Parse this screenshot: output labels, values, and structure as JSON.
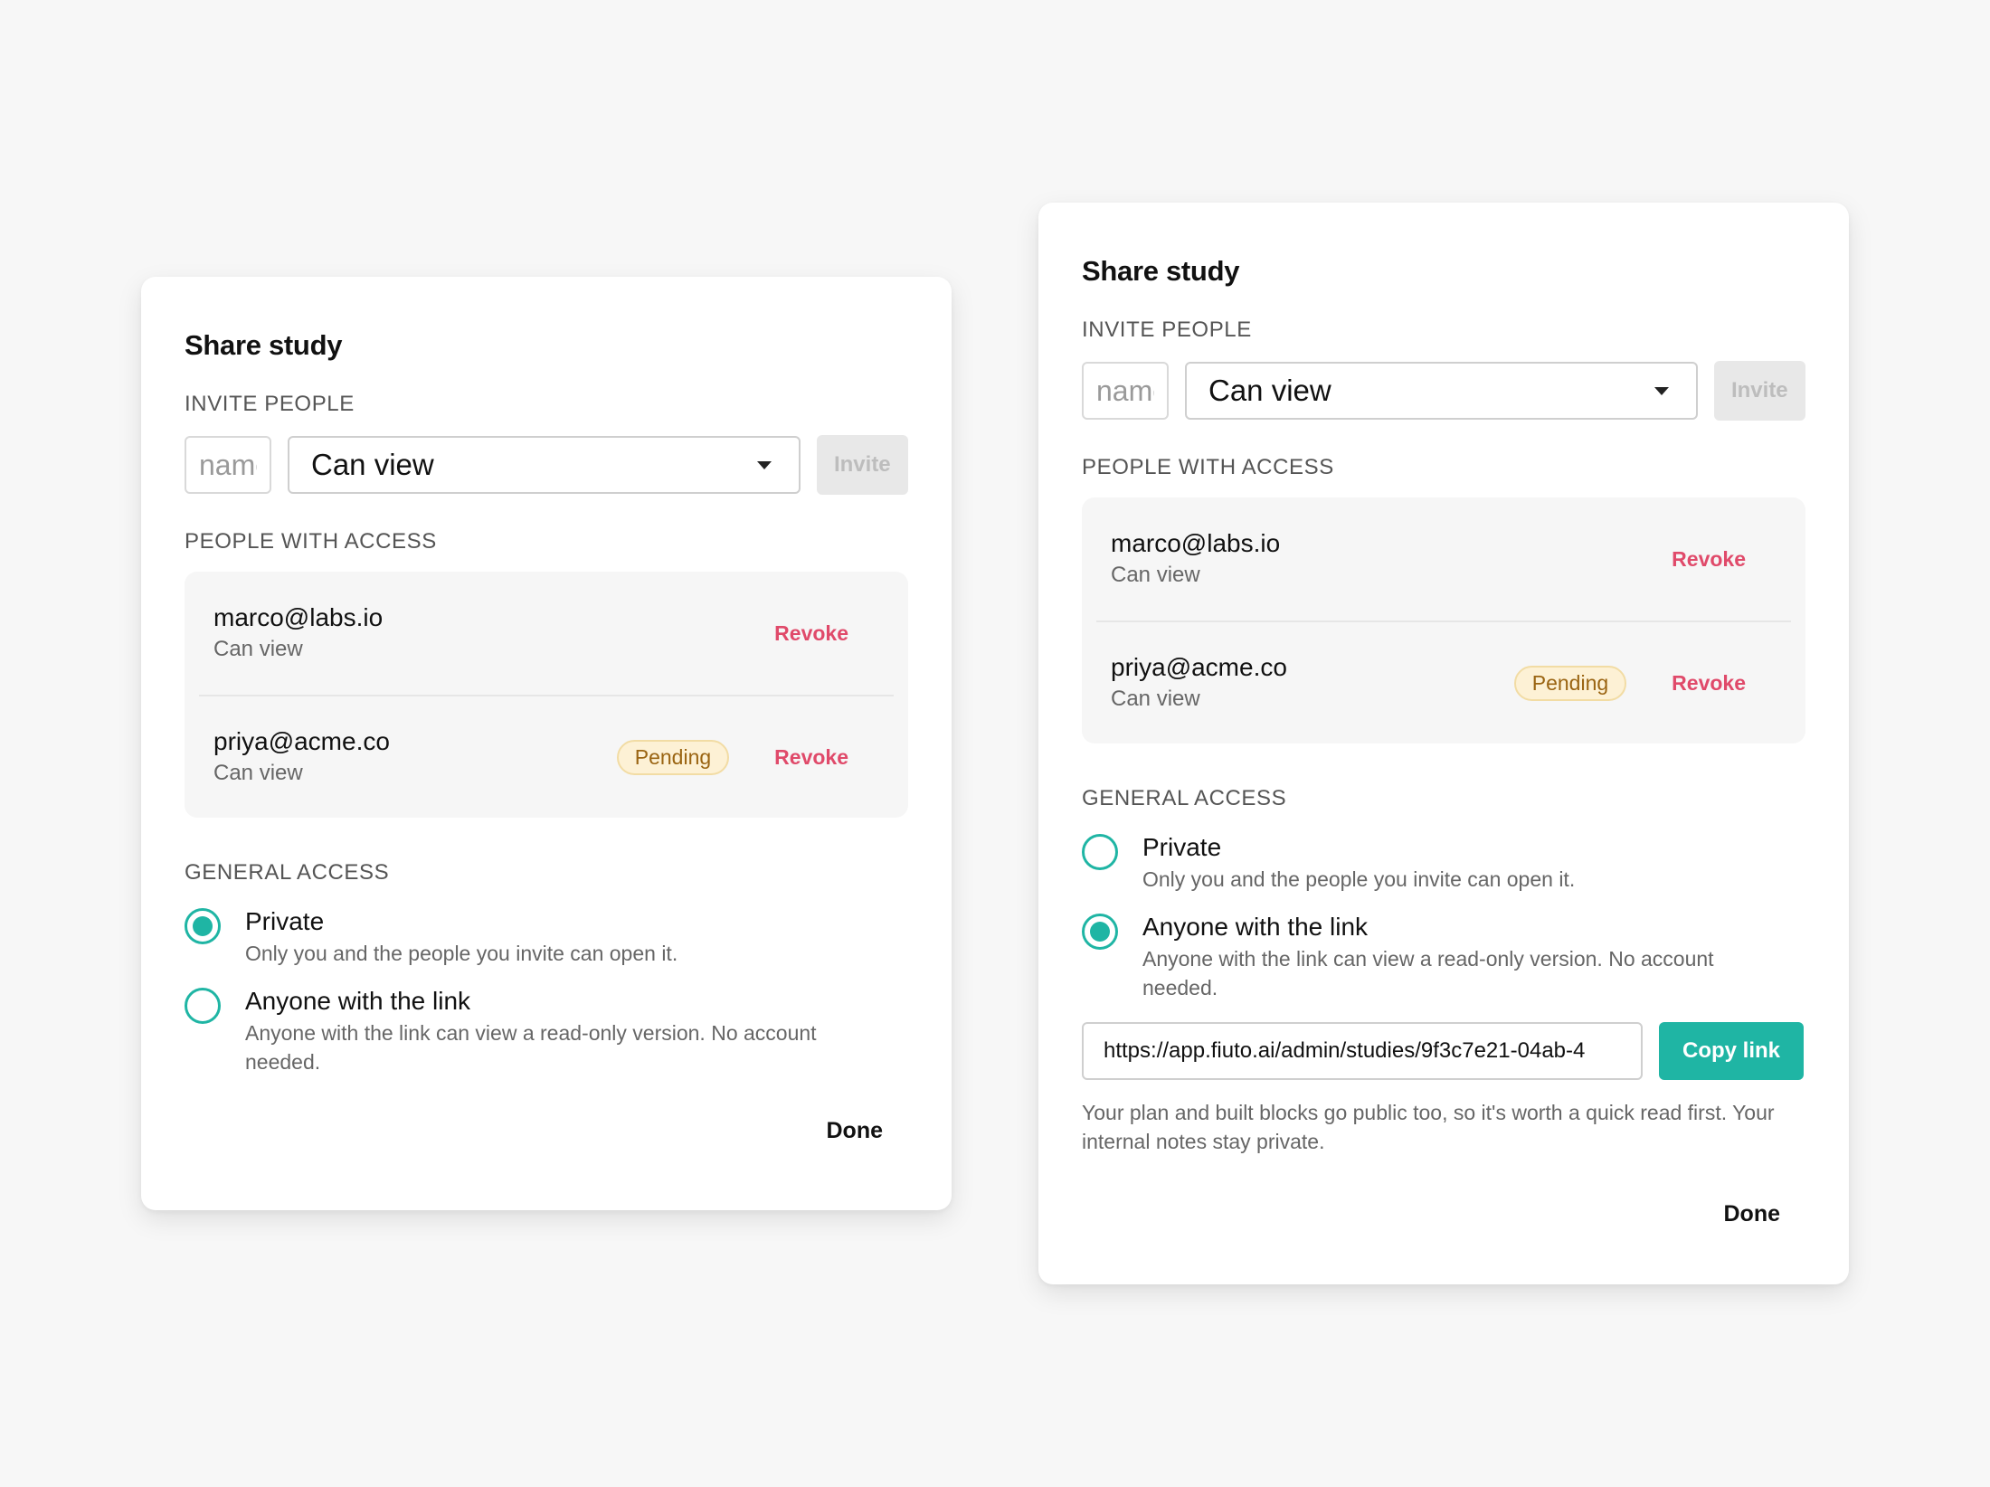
{
  "dialogs": [
    {
      "title": "Share study",
      "invite_label": "INVITE PEOPLE",
      "name_placeholder": "name@example.com",
      "role_value": "Can view",
      "invite_button": "Invite",
      "people_label": "PEOPLE WITH ACCESS",
      "people": [
        {
          "email": "marco@labs.io",
          "role": "Can view",
          "badge": "",
          "action": "Revoke"
        },
        {
          "email": "priya@acme.co",
          "role": "Can view",
          "badge": "Pending",
          "action": "Revoke"
        }
      ],
      "general_label": "GENERAL ACCESS",
      "options": [
        {
          "title": "Private",
          "desc": "Only you and the people you invite can open it.",
          "selected": true
        },
        {
          "title": "Anyone with the link",
          "desc": "Anyone with the link can view a read-only version. No account needed.",
          "selected": false
        }
      ],
      "done_button": "Done"
    },
    {
      "title": "Share study",
      "invite_label": "INVITE PEOPLE",
      "name_placeholder": "name@example.com",
      "role_value": "Can view",
      "invite_button": "Invite",
      "people_label": "PEOPLE WITH ACCESS",
      "people": [
        {
          "email": "marco@labs.io",
          "role": "Can view",
          "badge": "",
          "action": "Revoke"
        },
        {
          "email": "priya@acme.co",
          "role": "Can view",
          "badge": "Pending",
          "action": "Revoke"
        }
      ],
      "general_label": "GENERAL ACCESS",
      "options": [
        {
          "title": "Private",
          "desc": "Only you and the people you invite can open it.",
          "selected": false
        },
        {
          "title": "Anyone with the link",
          "desc": "Anyone with the link can view a read-only version. No account needed.",
          "selected": true
        }
      ],
      "share_link": "https://app.fiuto.ai/admin/studies/9f3c7e21-04ab-4",
      "copy_button": "Copy link",
      "note": "Your plan and built blocks go public too, so it's worth a quick read first. Your internal notes stay private.",
      "done_button": "Done"
    }
  ],
  "colors": {
    "accent": "#1fb5a4",
    "revoke": "#e04a6a",
    "pending_bg": "#fdf1d5",
    "pending_text": "#9a6412"
  }
}
